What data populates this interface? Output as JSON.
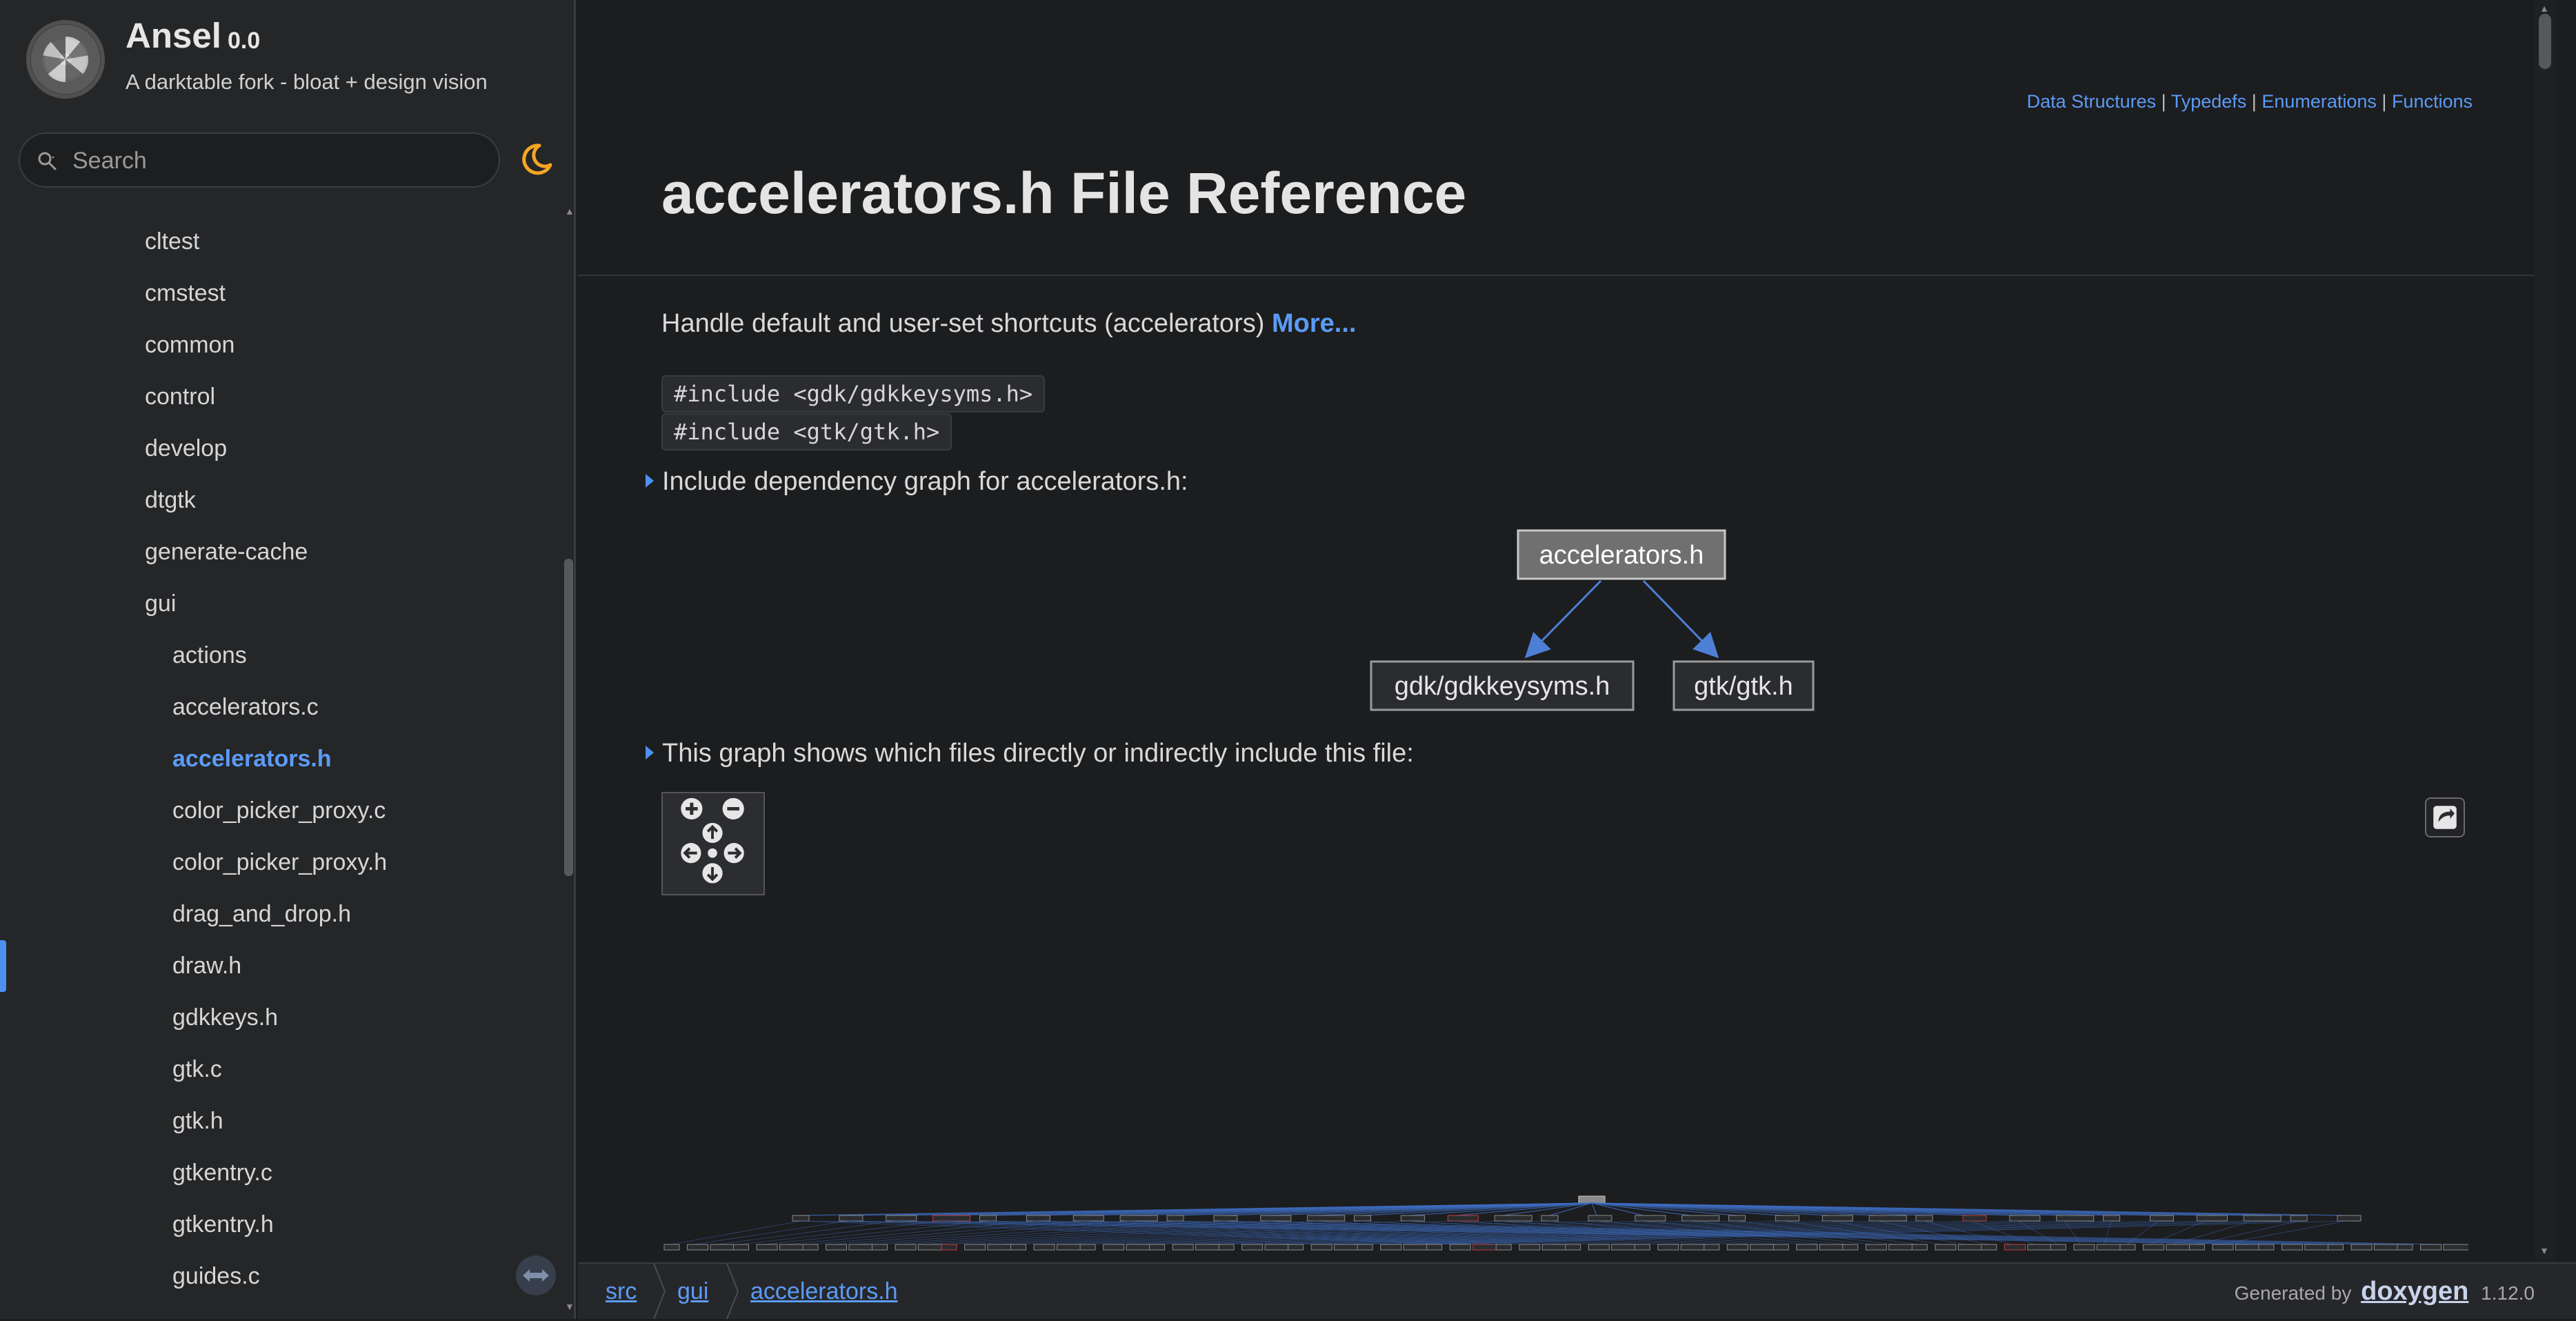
{
  "project": {
    "name": "Ansel",
    "number": "0.0",
    "brief": "A darktable fork - bloat + design vision"
  },
  "search": {
    "placeholder": "Search"
  },
  "nav": {
    "items": [
      {
        "label": "cltest",
        "level": 1
      },
      {
        "label": "cmstest",
        "level": 1
      },
      {
        "label": "common",
        "level": 1
      },
      {
        "label": "control",
        "level": 1
      },
      {
        "label": "develop",
        "level": 1
      },
      {
        "label": "dtgtk",
        "level": 1
      },
      {
        "label": "generate-cache",
        "level": 1
      },
      {
        "label": "gui",
        "level": 1
      },
      {
        "label": "actions",
        "level": 2
      },
      {
        "label": "accelerators.c",
        "level": 2
      },
      {
        "label": "accelerators.h",
        "level": 2,
        "selected": true
      },
      {
        "label": "color_picker_proxy.c",
        "level": 2
      },
      {
        "label": "color_picker_proxy.h",
        "level": 2
      },
      {
        "label": "drag_and_drop.h",
        "level": 2
      },
      {
        "label": "draw.h",
        "level": 2
      },
      {
        "label": "gdkkeys.h",
        "level": 2
      },
      {
        "label": "gtk.c",
        "level": 2
      },
      {
        "label": "gtk.h",
        "level": 2
      },
      {
        "label": "gtkentry.c",
        "level": 2
      },
      {
        "label": "gtkentry.h",
        "level": 2
      },
      {
        "label": "guides.c",
        "level": 2
      }
    ]
  },
  "header": {
    "links": [
      "Data Structures",
      "Typedefs",
      "Enumerations",
      "Functions"
    ],
    "title": "accelerators.h File Reference"
  },
  "content": {
    "brief": "Handle default and user-set shortcuts (accelerators)",
    "more": "More...",
    "includes": [
      "#include <gdk/gdkkeysyms.h>",
      "#include <gtk/gtk.h>"
    ],
    "dep_graph_header": "Include dependency graph for accelerators.h:",
    "included_by_header": "This graph shows which files directly or indirectly include this file:",
    "dep_graph": {
      "root": "accelerators.h",
      "children": [
        "gdk/gdkkeysyms.h",
        "gtk/gtk.h"
      ]
    }
  },
  "footer": {
    "breadcrumb": [
      "src",
      "gui",
      "accelerators.h"
    ],
    "generated_by": "Generated by",
    "tool": "doxygen",
    "version": "1.12.0"
  },
  "colors": {
    "background": "#1c1d1f",
    "sidebar": "#252628",
    "accent": "#5b9bf5",
    "graph_node_fill": "#707070",
    "theme_icon": "#f5a623"
  },
  "icons": {
    "search": "search-icon",
    "theme": "moon-icon",
    "expand": "expand-icon"
  }
}
